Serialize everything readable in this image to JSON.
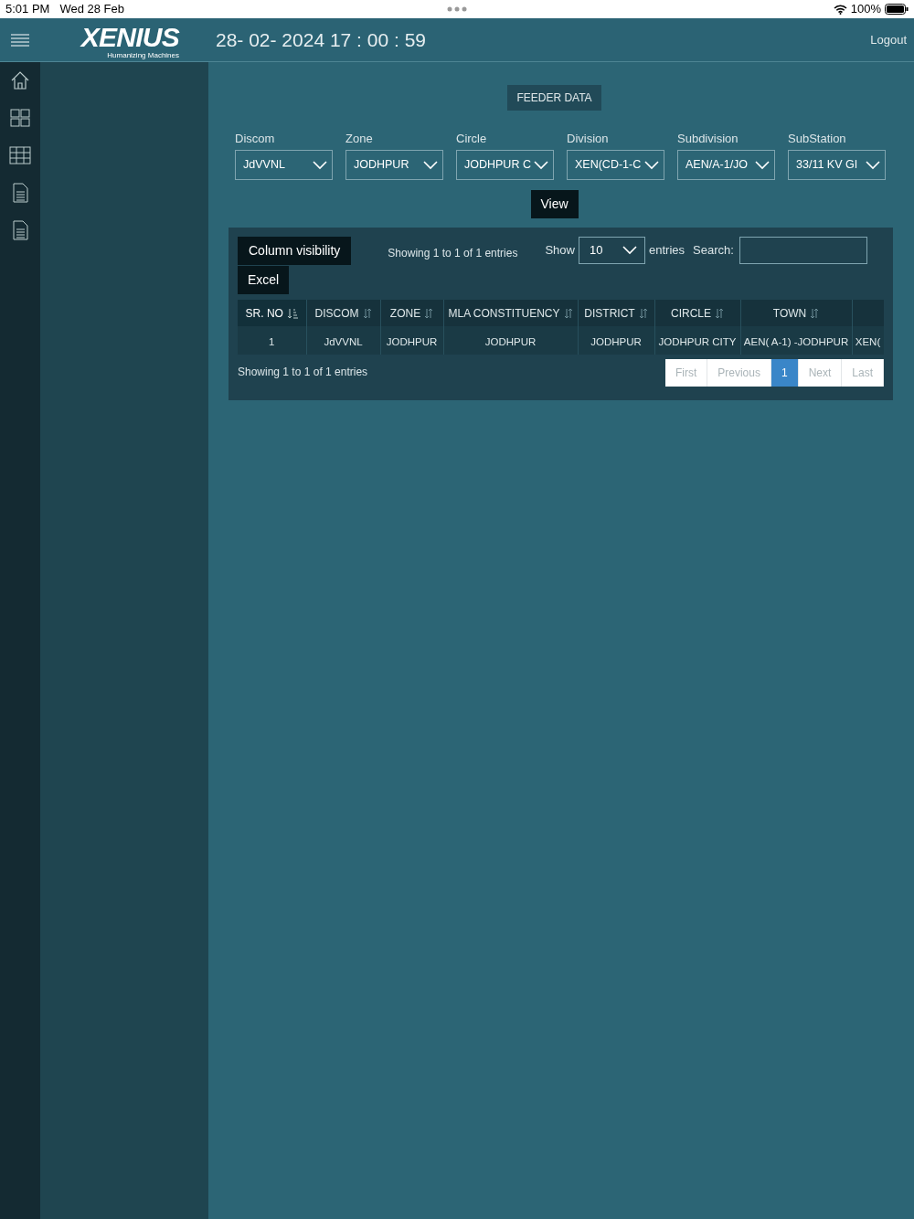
{
  "status_bar": {
    "time": "5:01 PM",
    "date": "Wed 28 Feb",
    "battery": "100%"
  },
  "header": {
    "logo": "XENIUS",
    "tagline": "Humanizing Machines",
    "datetime": "28- 02- 2024 17 : 00 : 59",
    "logout": "Logout"
  },
  "title": "FEEDER DATA",
  "filters": [
    {
      "label": "Discom",
      "value": "JdVVNL"
    },
    {
      "label": "Zone",
      "value": "JODHPUR"
    },
    {
      "label": "Circle",
      "value": "JODHPUR C"
    },
    {
      "label": "Division",
      "value": "XEN(CD-1-C"
    },
    {
      "label": "Subdivision",
      "value": "AEN/A-1/JO"
    },
    {
      "label": "SubStation",
      "value": "33/11 KV GI"
    }
  ],
  "view_button": "View",
  "table_panel": {
    "column_visibility": "Column visibility",
    "excel": "Excel",
    "info_top": "Showing 1 to 1 of 1 entries",
    "show": "Show",
    "page_size": "10",
    "entries": "entries",
    "search": "Search:",
    "columns": [
      {
        "label": "SR. NO",
        "sorted": true
      },
      {
        "label": "DISCOM",
        "sorted": false
      },
      {
        "label": "ZONE",
        "sorted": false
      },
      {
        "label": "MLA CONSTITUENCY",
        "sorted": false
      },
      {
        "label": "DISTRICT",
        "sorted": false
      },
      {
        "label": "CIRCLE",
        "sorted": false
      },
      {
        "label": "TOWN",
        "sorted": false
      }
    ],
    "rows": [
      [
        "1",
        "JdVVNL",
        "JODHPUR",
        "JODHPUR",
        "JODHPUR",
        "JODHPUR CITY",
        "AEN( A-1) -JODHPUR",
        "XEN("
      ]
    ],
    "info_bottom": "Showing 1 to 1 of 1 entries",
    "pagination": [
      {
        "label": "First",
        "selected": false,
        "disabled": true
      },
      {
        "label": "Previous",
        "selected": false,
        "disabled": true
      },
      {
        "label": "1",
        "selected": true,
        "disabled": false
      },
      {
        "label": "Next",
        "selected": false,
        "disabled": true
      },
      {
        "label": "Last",
        "selected": false,
        "disabled": true
      }
    ]
  }
}
